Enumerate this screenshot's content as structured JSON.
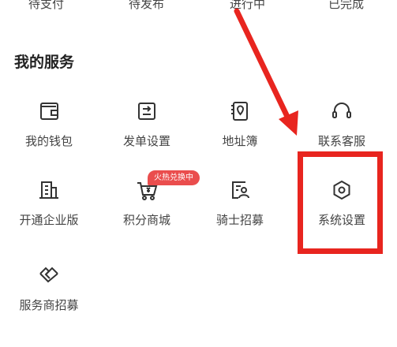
{
  "order_status": [
    {
      "label": "待支付"
    },
    {
      "label": "待发布"
    },
    {
      "label": "进行中"
    },
    {
      "label": "已完成"
    }
  ],
  "services": {
    "title": "我的服务",
    "items": [
      {
        "label": "我的钱包",
        "icon": "wallet-icon"
      },
      {
        "label": "发单设置",
        "icon": "send-order-settings-icon"
      },
      {
        "label": "地址簿",
        "icon": "address-book-icon"
      },
      {
        "label": "联系客服",
        "icon": "headset-icon"
      },
      {
        "label": "开通企业版",
        "icon": "building-icon"
      },
      {
        "label": "积分商城",
        "icon": "shopping-cart-icon",
        "badge": "火热兑换中"
      },
      {
        "label": "骑士招募",
        "icon": "rider-recruit-icon"
      },
      {
        "label": "系统设置",
        "icon": "hexagon-settings-icon"
      },
      {
        "label": "服务商招募",
        "icon": "handshake-icon"
      }
    ]
  },
  "colors": {
    "annotation": "#e8251f",
    "badge": "#ea4d4d"
  }
}
